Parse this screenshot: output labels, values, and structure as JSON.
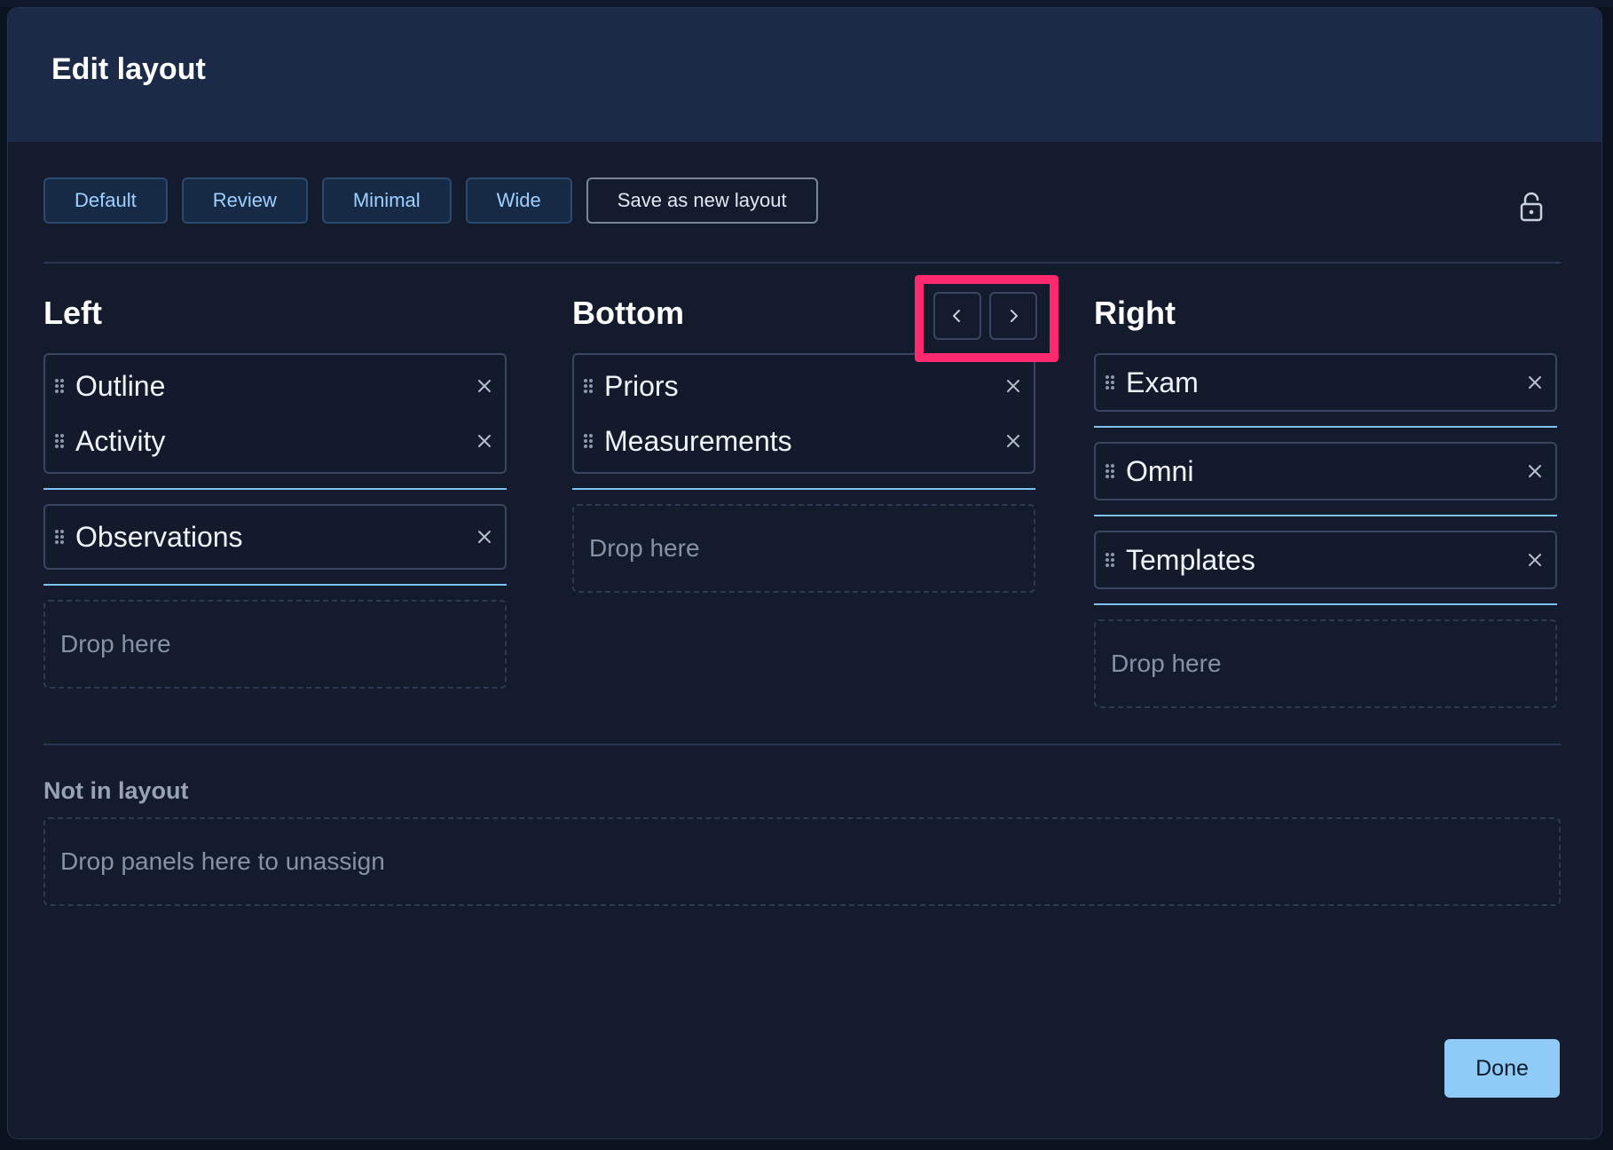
{
  "modal": {
    "title": "Edit layout"
  },
  "presets": {
    "default_label": "Default",
    "review_label": "Review",
    "minimal_label": "Minimal",
    "wide_label": "Wide",
    "save_label": "Save as new layout",
    "lock_icon": "lock-open-icon"
  },
  "columns": {
    "left": {
      "title": "Left",
      "groups": [
        [
          "Outline",
          "Activity"
        ],
        [
          "Observations"
        ]
      ],
      "drop_label": "Drop here"
    },
    "bottom": {
      "title": "Bottom",
      "groups": [
        [
          "Priors",
          "Measurements"
        ]
      ],
      "drop_label": "Drop here",
      "nav": {
        "prev_icon": "chevron-left-icon",
        "next_icon": "chevron-right-icon"
      }
    },
    "right": {
      "title": "Right",
      "groups": [
        [
          "Exam"
        ],
        [
          "Omni"
        ],
        [
          "Templates"
        ]
      ],
      "drop_label": "Drop here"
    }
  },
  "unassigned": {
    "title": "Not in layout",
    "drop_label": "Drop panels here to unassign"
  },
  "footer": {
    "done_label": "Done"
  },
  "colors": {
    "header_bg": "#1b2a47",
    "modal_bg": "#131b2c",
    "accent": "#8ecbf7",
    "highlight": "#ff2a6d",
    "separator": "#7cc3f2"
  }
}
